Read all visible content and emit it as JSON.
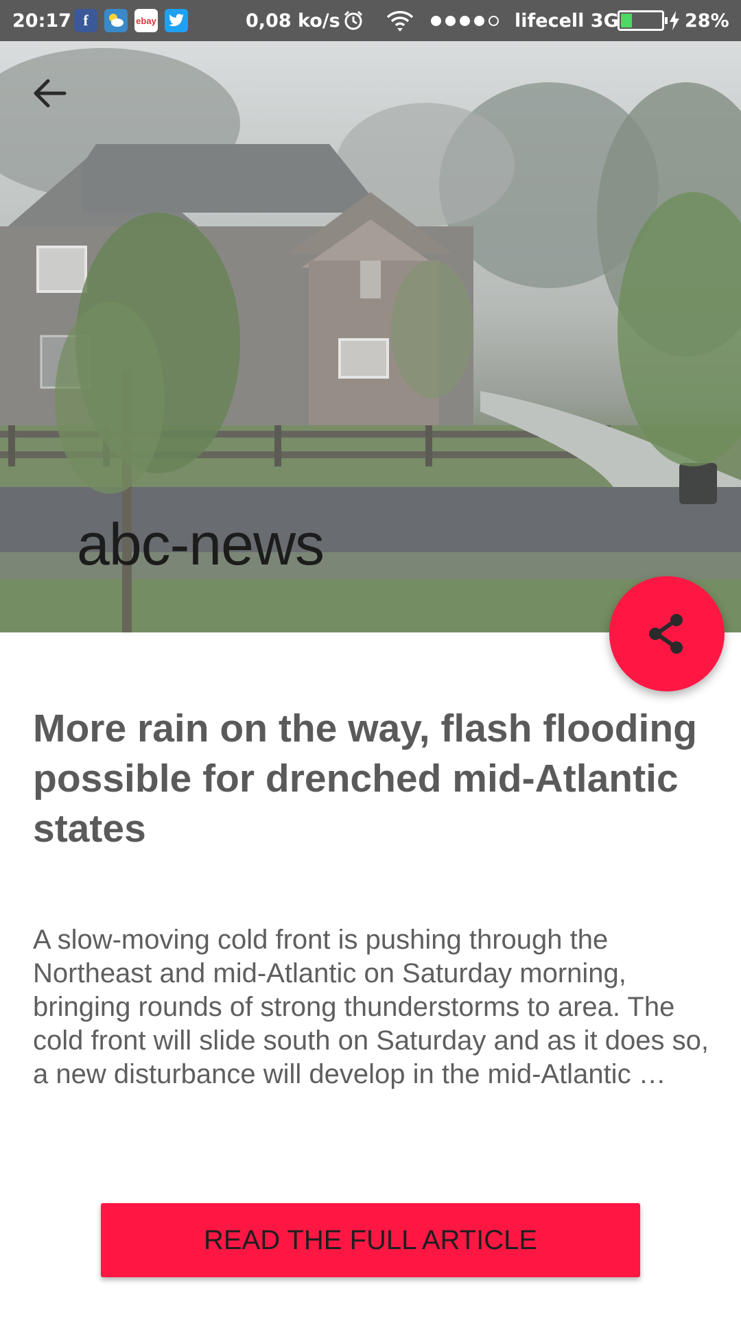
{
  "status_bar": {
    "time": "20:17",
    "app_icons": [
      "facebook-icon",
      "weather-icon",
      "ebay-icon",
      "twitter-icon"
    ],
    "ebay_label": "ebay",
    "net_speed": "0,08 ko/s",
    "carrier": "lifecell 3G",
    "signal_bars_filled": 4,
    "signal_bars_total": 5,
    "battery_percent": "28%",
    "battery_level": 0.28
  },
  "hero": {
    "source": "abc-news"
  },
  "article": {
    "title": "More rain on the way, flash flooding possible for drenched mid-Atlantic states",
    "summary": "A slow-moving cold front is pushing through the Northeast and mid-Atlantic on Saturday morning, bringing rounds of strong thunderstorms to area. The cold front will slide south on Saturday and as it does so, a new disturbance will develop in the mid-Atlantic …"
  },
  "actions": {
    "read_full": "READ THE FULL ARTICLE"
  },
  "colors": {
    "accent": "#ff1744",
    "status_bar": "#5a5a5a",
    "text": "#5a5a5a"
  }
}
